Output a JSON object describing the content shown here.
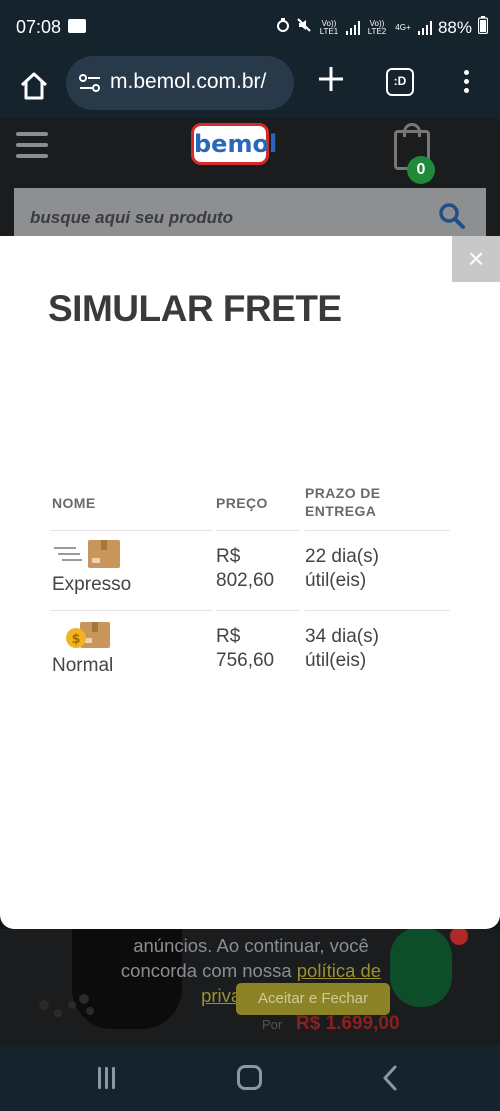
{
  "status_bar": {
    "time": "07:08",
    "volte1": "Vo)) LTE1",
    "volte2": "Vo)) LTE2",
    "net": "4G+",
    "battery": "88%"
  },
  "browser": {
    "url": "m.bemol.com.br/",
    "tabs_glyph": ":D"
  },
  "site": {
    "logo": "bemol",
    "cart_count": "0",
    "search_placeholder": "busque aqui seu produto"
  },
  "modal": {
    "title": "SIMULAR FRETE",
    "close_label": "×",
    "columns": [
      "NOME",
      "PREÇO",
      "PRAZO DE ENTREGA"
    ],
    "rows": [
      {
        "name": "Expresso",
        "price_line1": "R$",
        "price_line2": "802,60",
        "deadline_line1": "22 dia(s)",
        "deadline_line2": "útil(eis)"
      },
      {
        "name": "Normal",
        "price_line1": "R$",
        "price_line2": "756,60",
        "deadline_line1": "34 dia(s)",
        "deadline_line2": "útil(eis)"
      }
    ]
  },
  "cookie": {
    "text_prefix": "anúncios. Ao continuar, você concorda com nossa ",
    "link": "política de privacidade.",
    "button": "Aceitar e Fechar"
  },
  "product_preview": {
    "price_label": "Por",
    "price_value": "R$ 1.699,00"
  },
  "colors": {
    "brand_blue": "#2b67b8",
    "brand_red": "#d42a2a",
    "cart_badge": "#1f8a3a"
  }
}
